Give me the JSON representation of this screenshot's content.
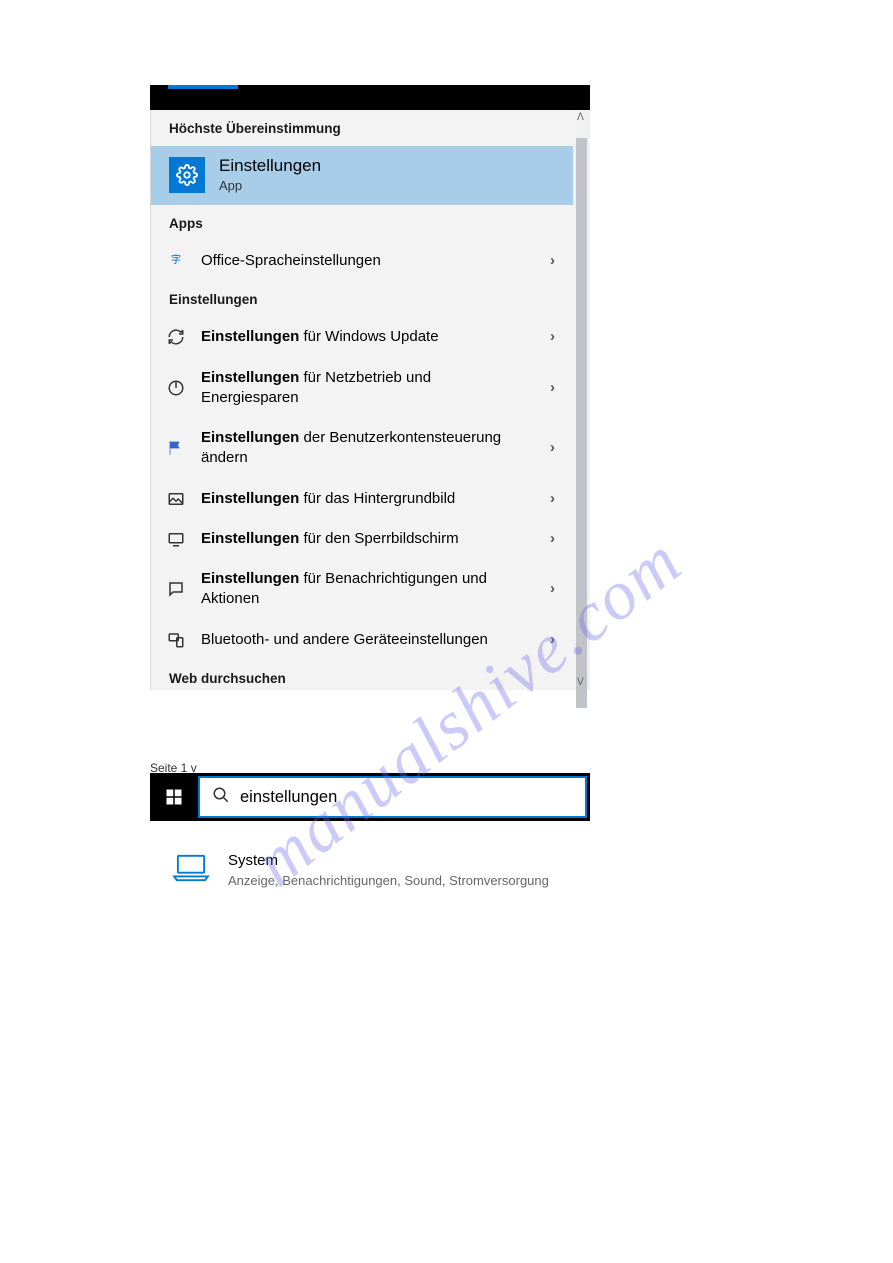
{
  "panel": {
    "best_header": "Höchste Übereinstimmung",
    "best_title": "Einstellungen",
    "best_sub": "App",
    "apps_header": "Apps",
    "apps_item": "Office-Spracheinstellungen",
    "settings_header": "Einstellungen",
    "items": [
      {
        "bold": "Einstellungen",
        "rest": " für Windows Update"
      },
      {
        "bold": "Einstellungen",
        "rest": " für Netzbetrieb und Energiesparen"
      },
      {
        "bold": "Einstellungen",
        "rest": " der Benutzerkontensteuerung ändern"
      },
      {
        "bold": "Einstellungen",
        "rest": " für das Hintergrundbild"
      },
      {
        "bold": "Einstellungen",
        "rest": " für den Sperrbildschirm"
      },
      {
        "bold": "Einstellungen",
        "rest": " für Benachrichtigungen und Aktionen"
      },
      {
        "bold": "",
        "rest": "Bluetooth- und andere Geräteeinstellungen"
      }
    ],
    "web_header": "Web durchsuchen"
  },
  "page_label": "Seite 1 v",
  "search": {
    "value": "einstellungen"
  },
  "system": {
    "title": "System",
    "desc": "Anzeige, Benachrichtigungen, Sound, Stromversorgung"
  },
  "watermark": "manualshive.com"
}
